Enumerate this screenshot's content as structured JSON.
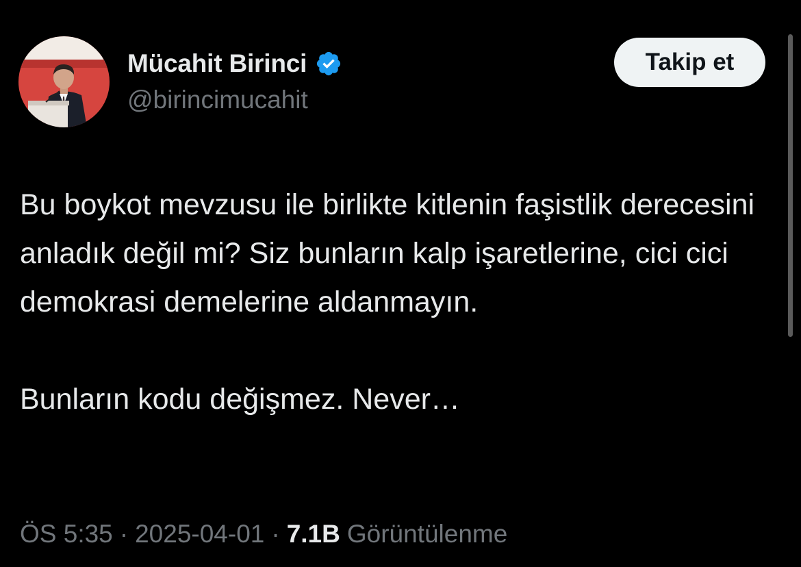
{
  "author": {
    "display_name": "Mücahit Birinci",
    "handle": "@birincimucahit",
    "verified": true,
    "verified_color": "#1d9bf0"
  },
  "follow_button": {
    "label": "Takip et"
  },
  "tweet": {
    "paragraphs": [
      "Bu boykot mevzusu ile birlikte kitlenin faşistlik derecesini anladık değil mi? Siz bunların kalp işaretlerine, cici cici demokrasi demelerine aldanmayın.",
      "Bunların kodu değişmez. Never…"
    ]
  },
  "meta": {
    "time": "ÖS 5:35",
    "date": "2025-04-01",
    "separator": "·",
    "views_count": "7.1B",
    "views_label": "Görüntülenme"
  },
  "colors": {
    "background": "#000000",
    "primary_text": "#e7e9ea",
    "secondary_text": "#71767b",
    "button_bg": "#eff3f4",
    "button_text": "#0f1419"
  }
}
